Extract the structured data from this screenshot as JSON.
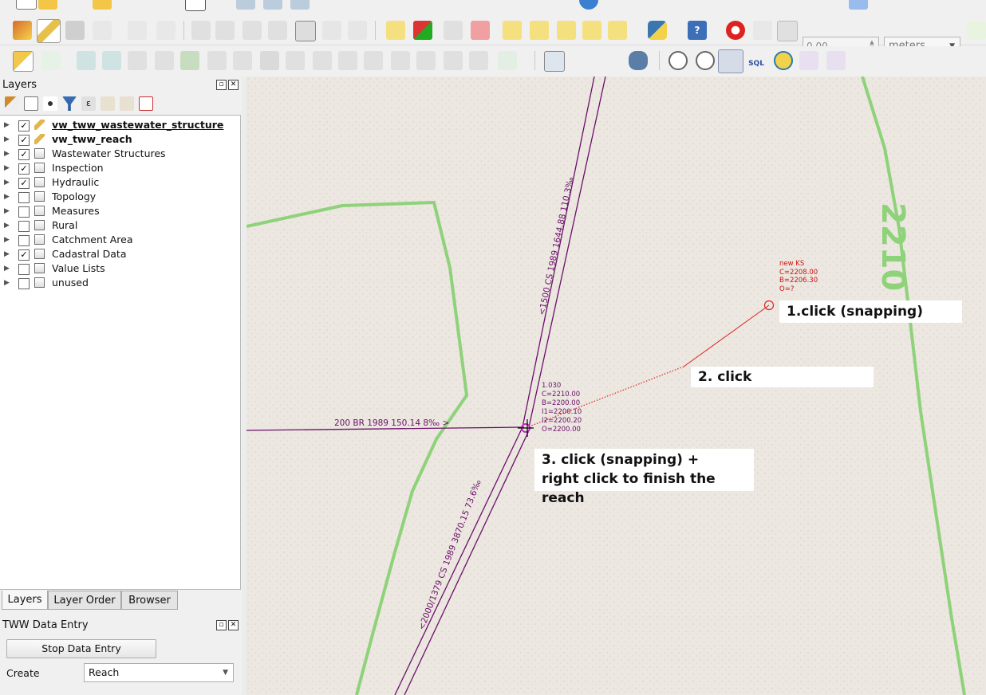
{
  "toolbar": {
    "scale_field_value": "0.00",
    "units_value": "meters",
    "sql_label": "SQL"
  },
  "layers_panel": {
    "title": "Layers",
    "layers": [
      {
        "name": "vw_tww_wastewater_structure",
        "checked": true,
        "icon": "edit-layer-icon",
        "bold": true,
        "underline": true
      },
      {
        "name": "vw_tww_reach",
        "checked": true,
        "icon": "edit-layer-icon",
        "bold": true,
        "underline": false
      },
      {
        "name": "Wastewater Structures",
        "checked": true,
        "icon": "group-icon"
      },
      {
        "name": "Inspection",
        "checked": true,
        "icon": "group-icon"
      },
      {
        "name": "Hydraulic",
        "checked": true,
        "icon": "group-icon"
      },
      {
        "name": "Topology",
        "checked": false,
        "icon": "group-icon"
      },
      {
        "name": "Measures",
        "checked": false,
        "icon": "group-icon"
      },
      {
        "name": "Rural",
        "checked": false,
        "icon": "group-icon"
      },
      {
        "name": "Catchment Area",
        "checked": false,
        "icon": "group-icon"
      },
      {
        "name": "Cadastral Data",
        "checked": true,
        "icon": "group-icon"
      },
      {
        "name": "Value Lists",
        "checked": false,
        "icon": "group-icon"
      },
      {
        "name": "unused",
        "checked": false,
        "icon": "group-icon"
      }
    ]
  },
  "dock_tabs": [
    "Layers",
    "Layer Order",
    "Browser"
  ],
  "tww_panel": {
    "title": "TWW Data Entry",
    "stop_button": "Stop Data Entry",
    "create_label": "Create",
    "create_value": "Reach"
  },
  "map": {
    "new_ks_label": "new KS\nC=2208.00\nB=2206.30\nO=?",
    "node_label": "1.030\nC=2210.00\nB=2200.00\nI1=2200.10\nI2=2200.20\nO=2200.00",
    "reach_upper_label": "<1500 CS 1989 1644.88 110.3‰",
    "reach_left_label": "200 BR 1989 150.14 8‰  >",
    "reach_lower_label": "<2000/1379 CS 1989 3870.15 73.6‰",
    "contour_label": "2210",
    "callout1": "1.click (snapping)",
    "callout2": "2. click",
    "callout3_line1": "3. click (snapping) +",
    "callout3_line2": "right click to finish the reach"
  },
  "colors": {
    "reach_line": "#6a106a",
    "new_reach": "#dd2222",
    "contour": "#8ed27a",
    "background": "#ece7e0"
  }
}
